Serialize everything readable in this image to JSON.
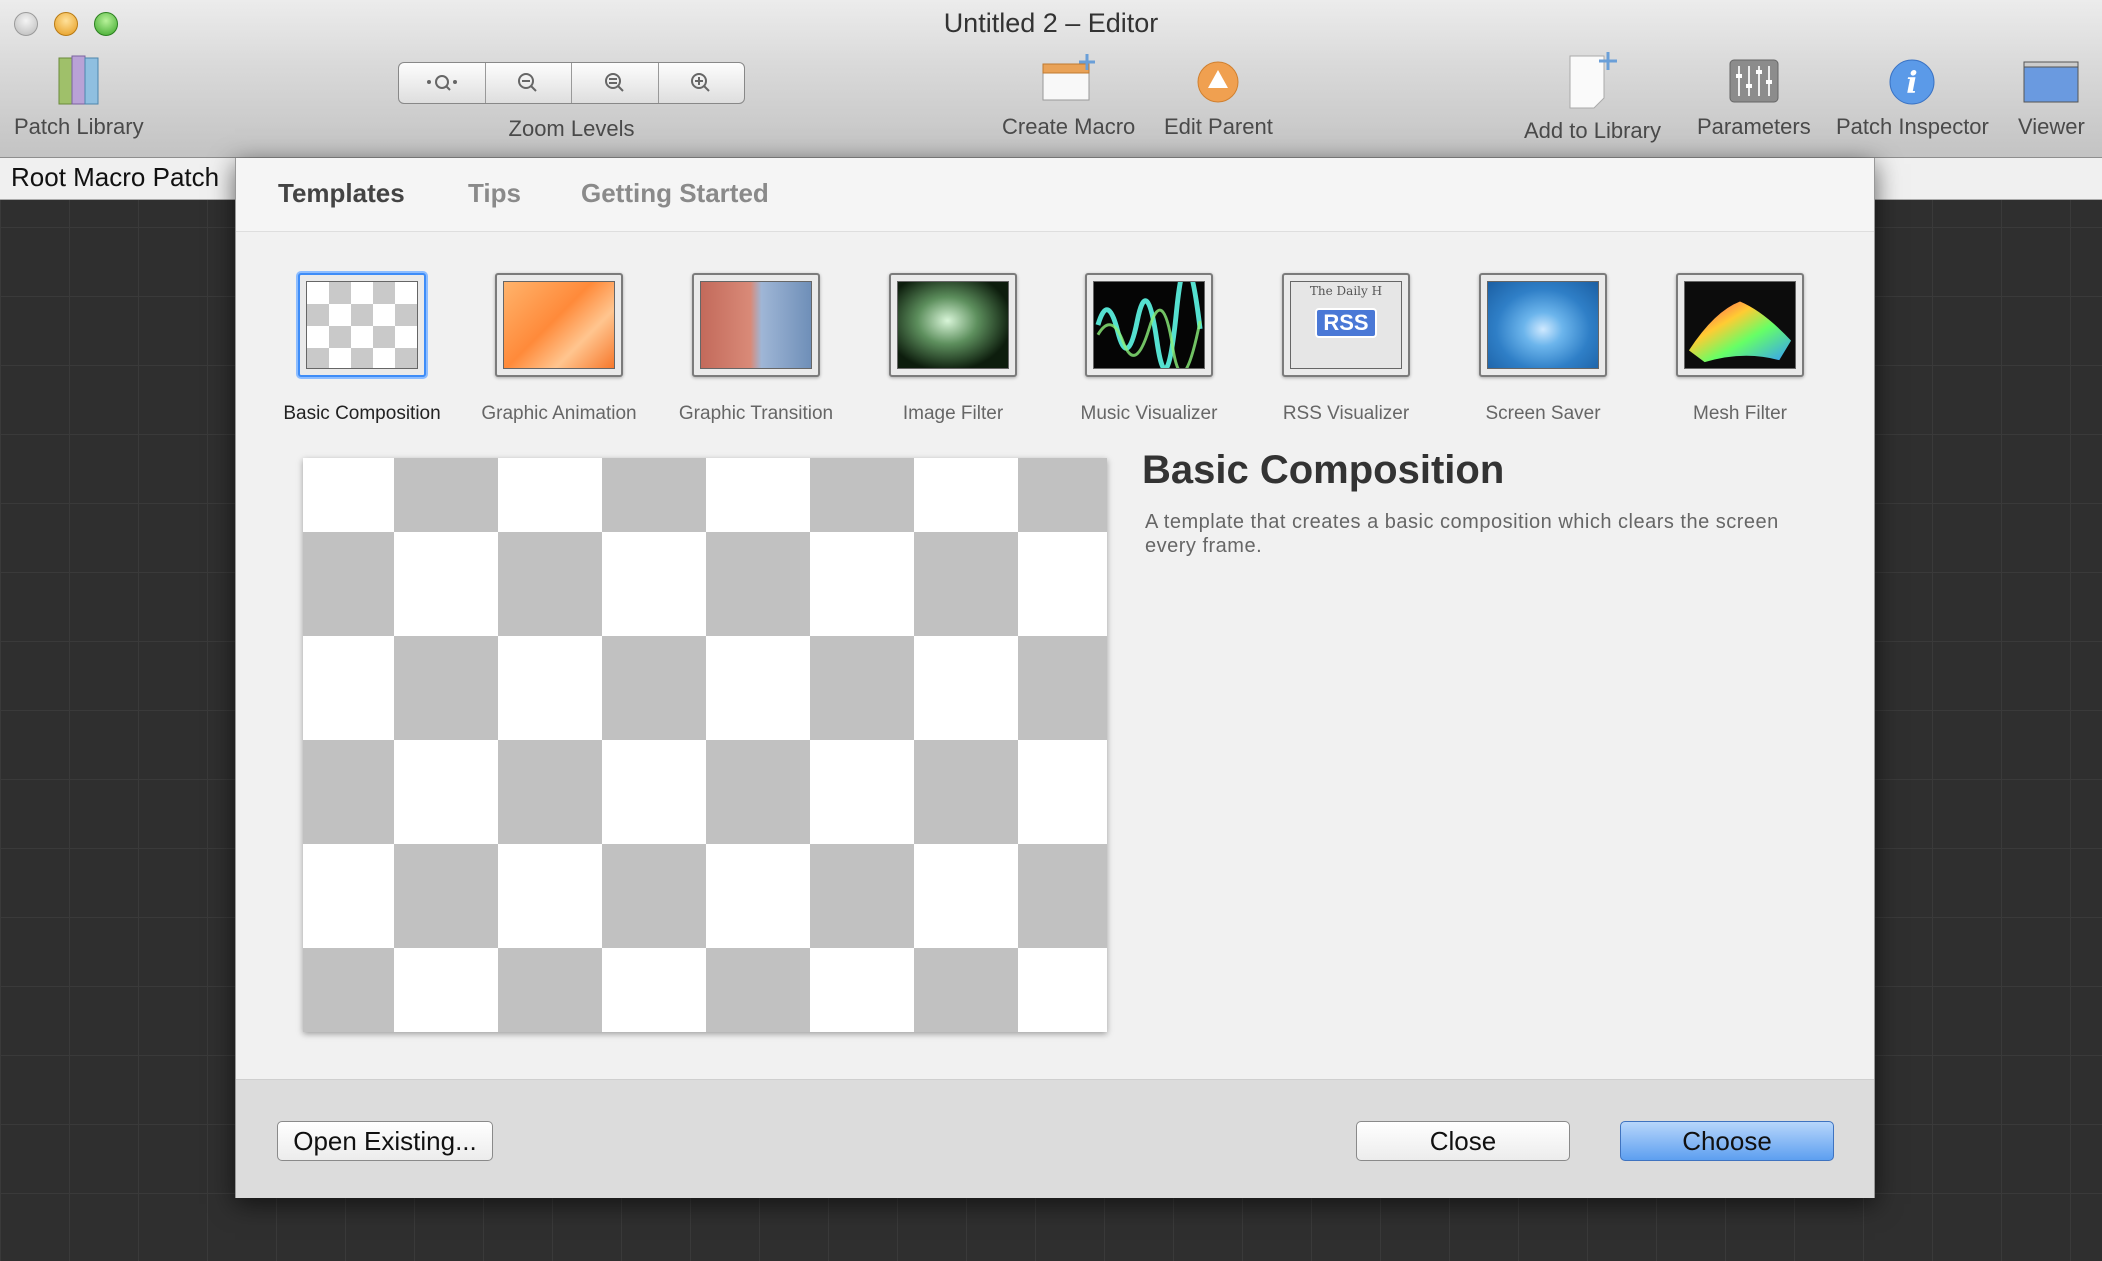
{
  "window": {
    "title": "Untitled 2 – Editor"
  },
  "toolbar": {
    "patch_library": "Patch Library",
    "zoom_levels": "Zoom Levels",
    "create_macro": "Create Macro",
    "edit_parent": "Edit Parent",
    "add_to_library": "Add to Library",
    "parameters": "Parameters",
    "patch_inspector": "Patch Inspector",
    "viewer": "Viewer"
  },
  "pathbar": {
    "label": "Root Macro Patch"
  },
  "sheet": {
    "tabs": [
      "Templates",
      "Tips",
      "Getting Started"
    ],
    "templates": [
      {
        "label": "Basic Composition",
        "selected": true
      },
      {
        "label": "Graphic Animation"
      },
      {
        "label": "Graphic Transition"
      },
      {
        "label": "Image Filter"
      },
      {
        "label": "Music Visualizer"
      },
      {
        "label": "RSS Visualizer"
      },
      {
        "label": "Screen Saver"
      },
      {
        "label": "Mesh Filter"
      }
    ],
    "detail": {
      "title": "Basic Composition",
      "description": "A template that creates a basic composition which clears the screen every frame."
    },
    "buttons": {
      "open_existing": "Open Existing...",
      "close": "Close",
      "choose": "Choose"
    }
  },
  "thumb_text": {
    "rss": "RSS",
    "daily": "The Daily H"
  }
}
